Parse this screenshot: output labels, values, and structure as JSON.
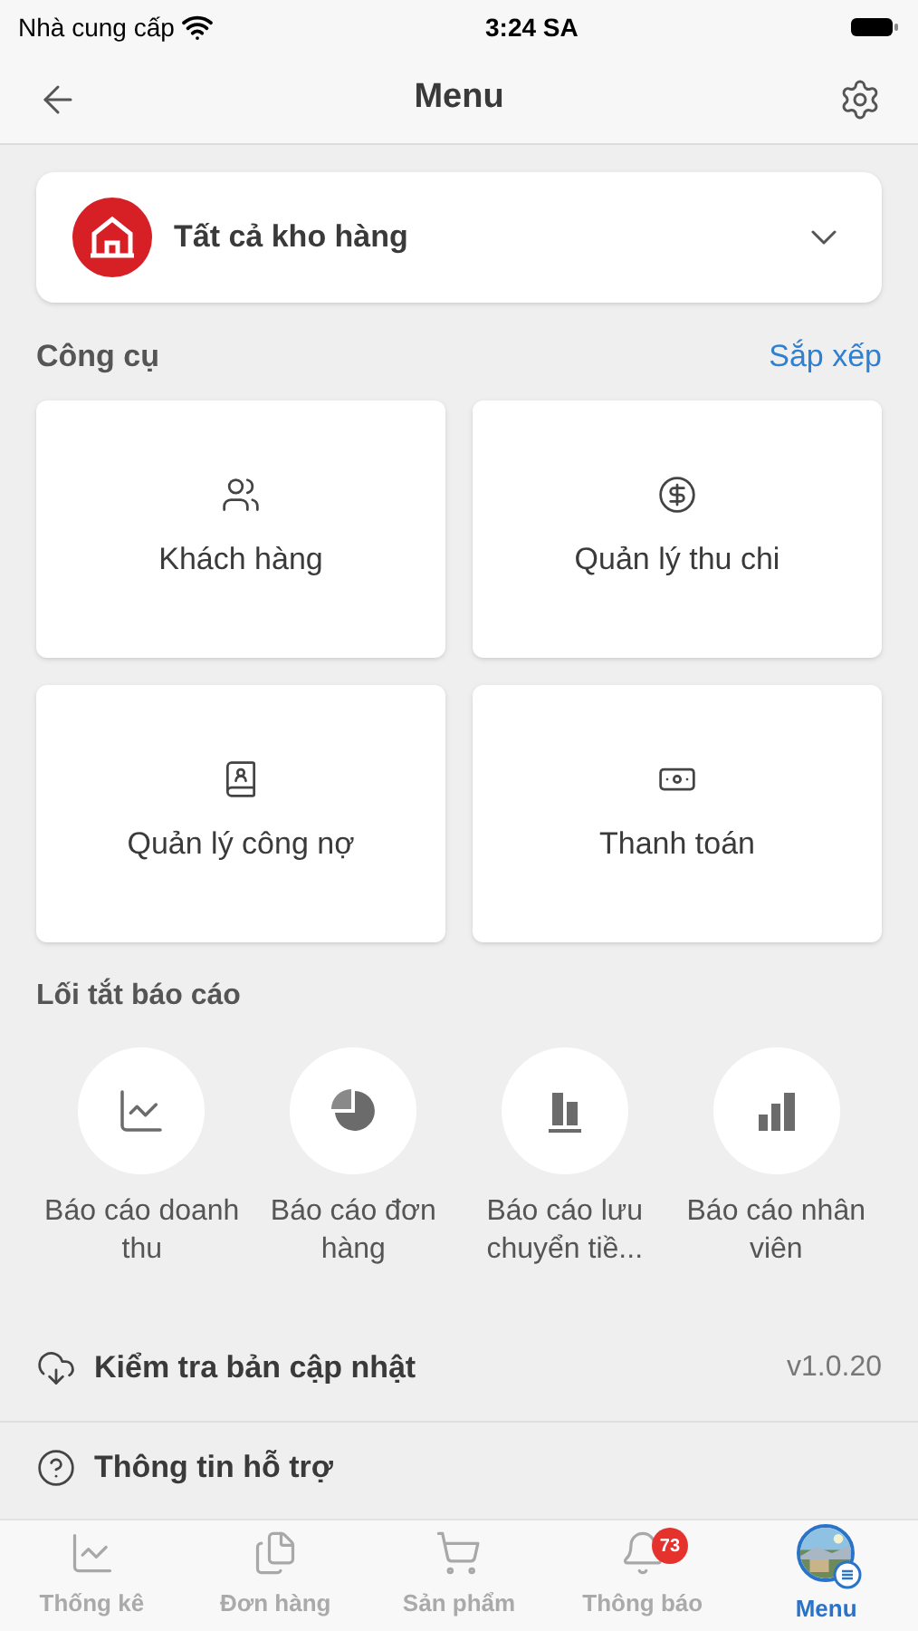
{
  "status_bar": {
    "carrier": "Nhà cung cấp",
    "time": "3:24 SA"
  },
  "header": {
    "title": "Menu"
  },
  "warehouse": {
    "label": "Tất cả kho hàng"
  },
  "tools": {
    "title": "Công cụ",
    "action": "Sắp xếp",
    "items": [
      {
        "kind": "customers",
        "label": "Khách hàng"
      },
      {
        "kind": "cashflow",
        "label": "Quản lý thu chi"
      },
      {
        "kind": "debt",
        "label": "Quản lý công nợ"
      },
      {
        "kind": "payment",
        "label": "Thanh toán"
      }
    ]
  },
  "reports": {
    "title": "Lối tắt báo cáo",
    "items": [
      {
        "kind": "line",
        "label": "Báo cáo doanh thu"
      },
      {
        "kind": "pie",
        "label": "Báo cáo đơn hàng"
      },
      {
        "kind": "bars",
        "label": "Báo cáo lưu chuyển tiề..."
      },
      {
        "kind": "steps",
        "label": "Báo cáo nhân viên"
      }
    ]
  },
  "update": {
    "label": "Kiểm tra bản cập nhật",
    "version": "v1.0.20"
  },
  "support": {
    "label": "Thông tin hỗ trợ"
  },
  "tab_bar": [
    {
      "kind": "stats",
      "label": "Thống kê",
      "selected": false
    },
    {
      "kind": "orders",
      "label": "Đơn hàng",
      "selected": false
    },
    {
      "kind": "products",
      "label": "Sản phẩm",
      "selected": false
    },
    {
      "kind": "notifications",
      "label": "Thông báo",
      "selected": false,
      "badge": "73"
    },
    {
      "kind": "menu",
      "label": "Menu",
      "selected": true
    }
  ]
}
